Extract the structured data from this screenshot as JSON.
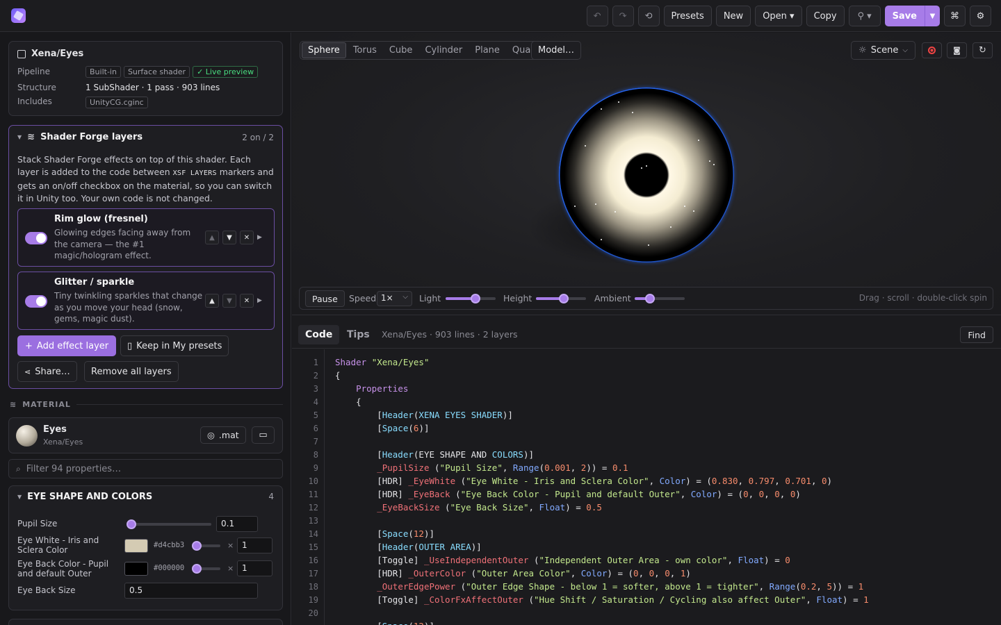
{
  "toolbar": {
    "buttons": [
      "Presets",
      "New",
      "Open ▾",
      "Copy",
      "Save"
    ],
    "icons": [
      "undo-icon",
      "redo-icon",
      "history-icon",
      "pin-icon",
      "command-icon",
      "settings-icon"
    ],
    "accent": "#a77ce8"
  },
  "shader_info": {
    "title": "Xena/Eyes",
    "rows": [
      {
        "label": "Pipeline",
        "chips": [
          "Built-in",
          "Surface shader",
          "✓ Live preview"
        ]
      },
      {
        "label": "Structure",
        "value": "1 SubShader · 1 pass · 903 lines"
      },
      {
        "label": "Includes",
        "chips": [
          "UnityCG.cginc"
        ]
      }
    ]
  },
  "layers": {
    "title": "Shader Forge layers",
    "count": "2 on / 2",
    "desc_a": "Stack Shader Forge effects on top of this shader. Each layer is added to the code between ",
    "marker": "XSF LAYERS",
    "desc_b": " markers and gets an on/off checkbox on the material, so you can switch it in Unity too. Your own code is not changed.",
    "items": [
      {
        "title": "Rim glow (fresnel)",
        "desc": "Glowing edges facing away from the camera — the #1 magic/hologram effect.",
        "enabled": true
      },
      {
        "title": "Glitter / sparkle",
        "desc": "Tiny twinkling sparkles that change as you move your head (snow, gems, magic dust).",
        "enabled": true
      }
    ],
    "add_label": "Add effect layer",
    "keep_label": "Keep in My presets",
    "share_label": "Share…",
    "remove_label": "Remove all layers"
  },
  "material": {
    "section": "MATERIAL",
    "name": "Eyes",
    "shader": "Xena/Eyes",
    "mat_button": ".mat",
    "filter_placeholder": "Filter 94 properties…"
  },
  "eye_group": {
    "title": "EYE SHAPE AND COLORS",
    "count": "4",
    "props": [
      {
        "label": "Pupil Size",
        "value": "0.1",
        "slider": 0.05
      },
      {
        "label": "Eye White - Iris and Sclera Color",
        "hex": "#d4cbb3",
        "intensity": "1",
        "color": "#d4cbb3"
      },
      {
        "label": "Eye Back Color - Pupil and default Outer",
        "hex": "#000000",
        "intensity": "1",
        "color": "#000000"
      },
      {
        "label": "Eye Back Size",
        "value": "0.5"
      }
    ]
  },
  "viewport": {
    "shapes": [
      "Sphere",
      "Torus",
      "Cube",
      "Cylinder",
      "Plane",
      "Quad"
    ],
    "active_shape": "Sphere",
    "model_label": "Model…",
    "scene_label": "Scene",
    "pause_label": "Pause",
    "speed_label": "Speed",
    "speed_value": "1×",
    "light_label": "Light",
    "light_level": 0.6,
    "height_label": "Height",
    "height_level": 0.55,
    "ambient_label": "Ambient",
    "ambient_level": 0.3,
    "hint": "Drag · scroll · double-click spin"
  },
  "code": {
    "tab_code": "Code",
    "tab_tips": "Tips",
    "meta": "Xena/Eyes · 903 lines · 2 layers",
    "find": "Find"
  }
}
